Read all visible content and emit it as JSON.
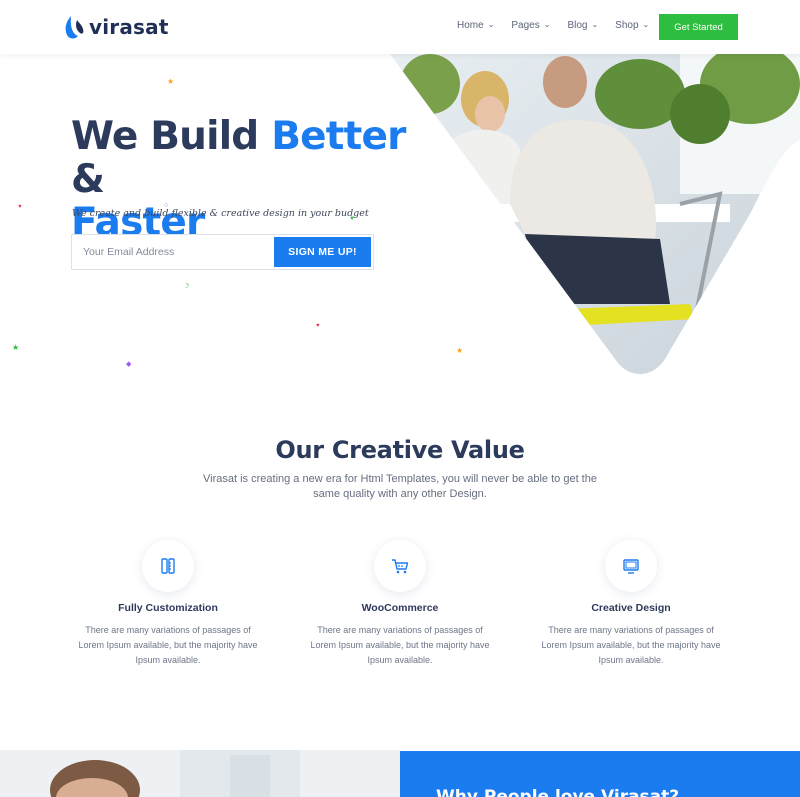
{
  "brand": {
    "name": "virasat"
  },
  "nav": {
    "items": [
      {
        "label": "Home"
      },
      {
        "label": "Pages"
      },
      {
        "label": "Blog"
      },
      {
        "label": "Shop"
      }
    ],
    "cta_label": "Get Started"
  },
  "hero": {
    "title_part1": "We Build ",
    "title_highlight1": "Better",
    "title_part2": " &",
    "title_highlight2": "Faster",
    "subtitle": "We create and build flexible & creative design in your budget",
    "email_placeholder": "Your Email Address",
    "signup_label": "SIGN ME UP!"
  },
  "values": {
    "title": "Our Creative Value",
    "description": "Virasat is creating a new era for Html Templates, you will never be able to get the same quality with any other Design.",
    "features": [
      {
        "title": "Fully Customization",
        "icon": "pencil-ruler-icon",
        "description": "There are many variations of passages of Lorem Ipsum available, but the majority have Ipsum available."
      },
      {
        "title": "WooCommerce",
        "icon": "shopping-cart-icon",
        "description": "There are many variations of passages of Lorem Ipsum available, but the majority have Ipsum available."
      },
      {
        "title": "Creative Design",
        "icon": "monitor-icon",
        "description": "There are many variations of passages of Lorem Ipsum available, but the majority have Ipsum available."
      }
    ]
  },
  "why": {
    "title": "Why People love Virasat?"
  },
  "colors": {
    "primary": "#1b7cf0",
    "dark": "#2c3a5c",
    "cta": "#2dbd3f"
  }
}
